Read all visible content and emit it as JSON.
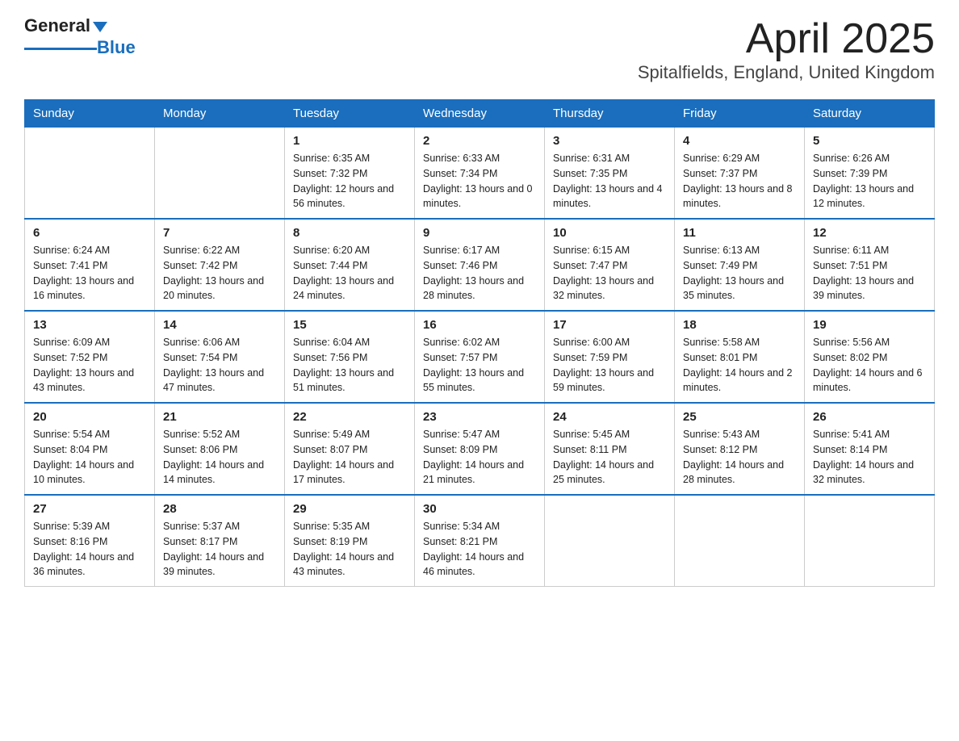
{
  "header": {
    "logo_text_black": "General",
    "logo_text_blue": "Blue",
    "title": "April 2025",
    "subtitle": "Spitalfields, England, United Kingdom"
  },
  "days_of_week": [
    "Sunday",
    "Monday",
    "Tuesday",
    "Wednesday",
    "Thursday",
    "Friday",
    "Saturday"
  ],
  "weeks": [
    [
      {
        "day": "",
        "info": ""
      },
      {
        "day": "",
        "info": ""
      },
      {
        "day": "1",
        "info": "Sunrise: 6:35 AM\nSunset: 7:32 PM\nDaylight: 12 hours\nand 56 minutes."
      },
      {
        "day": "2",
        "info": "Sunrise: 6:33 AM\nSunset: 7:34 PM\nDaylight: 13 hours\nand 0 minutes."
      },
      {
        "day": "3",
        "info": "Sunrise: 6:31 AM\nSunset: 7:35 PM\nDaylight: 13 hours\nand 4 minutes."
      },
      {
        "day": "4",
        "info": "Sunrise: 6:29 AM\nSunset: 7:37 PM\nDaylight: 13 hours\nand 8 minutes."
      },
      {
        "day": "5",
        "info": "Sunrise: 6:26 AM\nSunset: 7:39 PM\nDaylight: 13 hours\nand 12 minutes."
      }
    ],
    [
      {
        "day": "6",
        "info": "Sunrise: 6:24 AM\nSunset: 7:41 PM\nDaylight: 13 hours\nand 16 minutes."
      },
      {
        "day": "7",
        "info": "Sunrise: 6:22 AM\nSunset: 7:42 PM\nDaylight: 13 hours\nand 20 minutes."
      },
      {
        "day": "8",
        "info": "Sunrise: 6:20 AM\nSunset: 7:44 PM\nDaylight: 13 hours\nand 24 minutes."
      },
      {
        "day": "9",
        "info": "Sunrise: 6:17 AM\nSunset: 7:46 PM\nDaylight: 13 hours\nand 28 minutes."
      },
      {
        "day": "10",
        "info": "Sunrise: 6:15 AM\nSunset: 7:47 PM\nDaylight: 13 hours\nand 32 minutes."
      },
      {
        "day": "11",
        "info": "Sunrise: 6:13 AM\nSunset: 7:49 PM\nDaylight: 13 hours\nand 35 minutes."
      },
      {
        "day": "12",
        "info": "Sunrise: 6:11 AM\nSunset: 7:51 PM\nDaylight: 13 hours\nand 39 minutes."
      }
    ],
    [
      {
        "day": "13",
        "info": "Sunrise: 6:09 AM\nSunset: 7:52 PM\nDaylight: 13 hours\nand 43 minutes."
      },
      {
        "day": "14",
        "info": "Sunrise: 6:06 AM\nSunset: 7:54 PM\nDaylight: 13 hours\nand 47 minutes."
      },
      {
        "day": "15",
        "info": "Sunrise: 6:04 AM\nSunset: 7:56 PM\nDaylight: 13 hours\nand 51 minutes."
      },
      {
        "day": "16",
        "info": "Sunrise: 6:02 AM\nSunset: 7:57 PM\nDaylight: 13 hours\nand 55 minutes."
      },
      {
        "day": "17",
        "info": "Sunrise: 6:00 AM\nSunset: 7:59 PM\nDaylight: 13 hours\nand 59 minutes."
      },
      {
        "day": "18",
        "info": "Sunrise: 5:58 AM\nSunset: 8:01 PM\nDaylight: 14 hours\nand 2 minutes."
      },
      {
        "day": "19",
        "info": "Sunrise: 5:56 AM\nSunset: 8:02 PM\nDaylight: 14 hours\nand 6 minutes."
      }
    ],
    [
      {
        "day": "20",
        "info": "Sunrise: 5:54 AM\nSunset: 8:04 PM\nDaylight: 14 hours\nand 10 minutes."
      },
      {
        "day": "21",
        "info": "Sunrise: 5:52 AM\nSunset: 8:06 PM\nDaylight: 14 hours\nand 14 minutes."
      },
      {
        "day": "22",
        "info": "Sunrise: 5:49 AM\nSunset: 8:07 PM\nDaylight: 14 hours\nand 17 minutes."
      },
      {
        "day": "23",
        "info": "Sunrise: 5:47 AM\nSunset: 8:09 PM\nDaylight: 14 hours\nand 21 minutes."
      },
      {
        "day": "24",
        "info": "Sunrise: 5:45 AM\nSunset: 8:11 PM\nDaylight: 14 hours\nand 25 minutes."
      },
      {
        "day": "25",
        "info": "Sunrise: 5:43 AM\nSunset: 8:12 PM\nDaylight: 14 hours\nand 28 minutes."
      },
      {
        "day": "26",
        "info": "Sunrise: 5:41 AM\nSunset: 8:14 PM\nDaylight: 14 hours\nand 32 minutes."
      }
    ],
    [
      {
        "day": "27",
        "info": "Sunrise: 5:39 AM\nSunset: 8:16 PM\nDaylight: 14 hours\nand 36 minutes."
      },
      {
        "day": "28",
        "info": "Sunrise: 5:37 AM\nSunset: 8:17 PM\nDaylight: 14 hours\nand 39 minutes."
      },
      {
        "day": "29",
        "info": "Sunrise: 5:35 AM\nSunset: 8:19 PM\nDaylight: 14 hours\nand 43 minutes."
      },
      {
        "day": "30",
        "info": "Sunrise: 5:34 AM\nSunset: 8:21 PM\nDaylight: 14 hours\nand 46 minutes."
      },
      {
        "day": "",
        "info": ""
      },
      {
        "day": "",
        "info": ""
      },
      {
        "day": "",
        "info": ""
      }
    ]
  ]
}
